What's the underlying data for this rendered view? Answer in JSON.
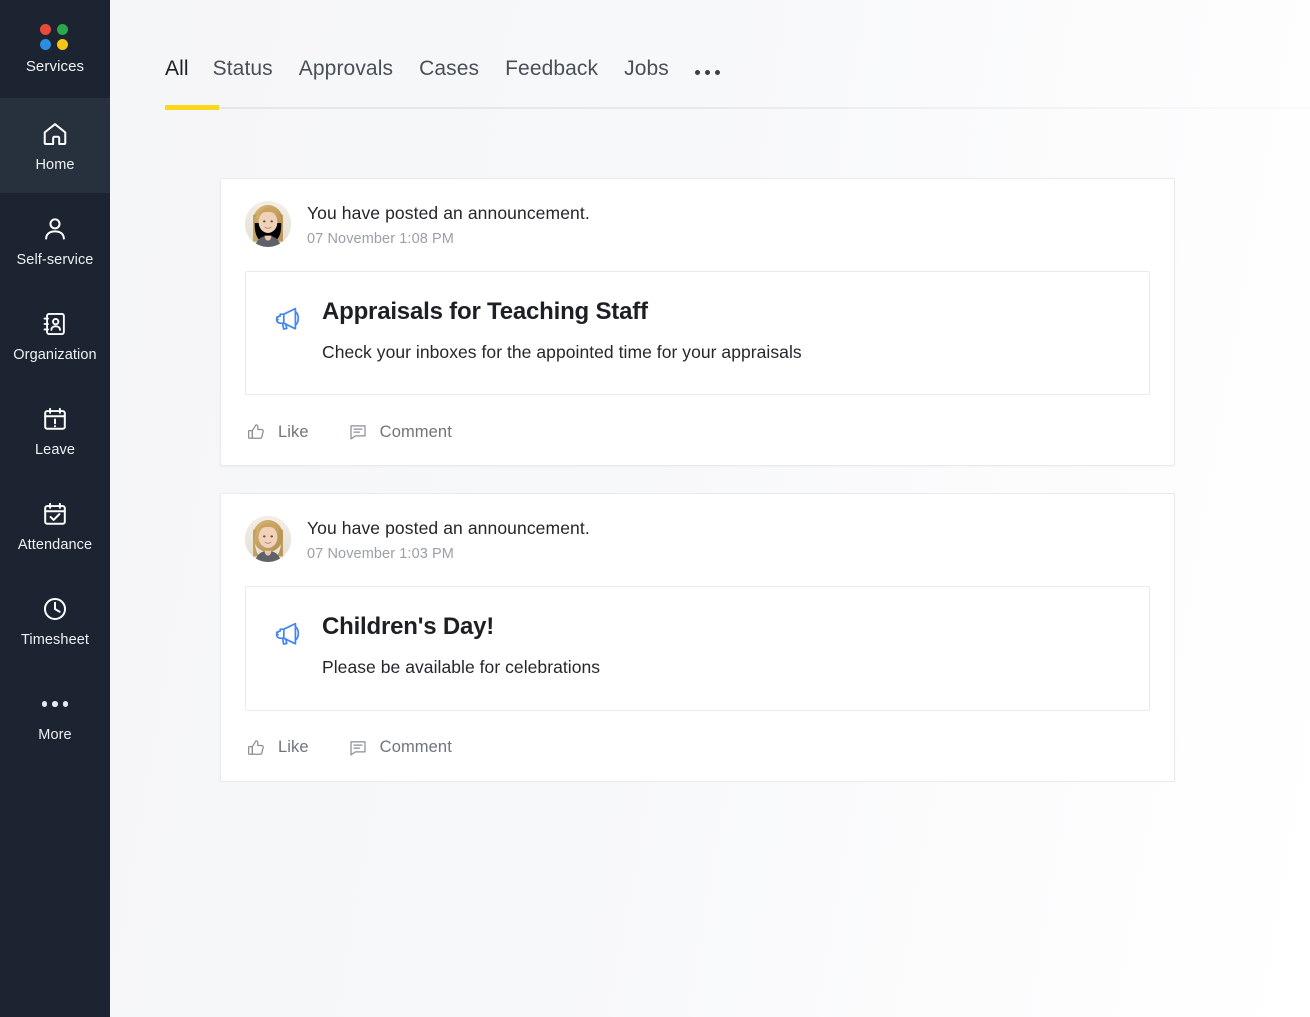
{
  "sidebar": {
    "brand": {
      "label": "Services",
      "dots": [
        {
          "name": "logo-dot-red",
          "color": "#e84b3c"
        },
        {
          "name": "logo-dot-green",
          "color": "#2aa84a"
        },
        {
          "name": "logo-dot-blue",
          "color": "#2c8ee0"
        },
        {
          "name": "logo-dot-yellow",
          "color": "#f5c518"
        }
      ]
    },
    "items": [
      {
        "label": "Home",
        "icon": "home-icon",
        "active": true
      },
      {
        "label": "Self-service",
        "icon": "user-icon",
        "active": false
      },
      {
        "label": "Organization",
        "icon": "address-book-icon",
        "active": false
      },
      {
        "label": "Leave",
        "icon": "calendar-alert-icon",
        "active": false
      },
      {
        "label": "Attendance",
        "icon": "calendar-check-icon",
        "active": false
      },
      {
        "label": "Timesheet",
        "icon": "clock-icon",
        "active": false
      },
      {
        "label": "More",
        "icon": "ellipsis-icon",
        "active": false
      }
    ]
  },
  "tabs": {
    "items": [
      {
        "label": "All",
        "active": true
      },
      {
        "label": "Status",
        "active": false
      },
      {
        "label": "Approvals",
        "active": false
      },
      {
        "label": "Cases",
        "active": false
      },
      {
        "label": "Feedback",
        "active": false
      },
      {
        "label": "Jobs",
        "active": false
      }
    ],
    "overflow_icon": "ellipsis-icon",
    "active_accent_color": "#f9d71c"
  },
  "feed": {
    "posts": [
      {
        "avatar": "user-avatar-photo",
        "header": "You have posted an announcement.",
        "timestamp": "07 November 1:08 PM",
        "announcement": {
          "icon": "megaphone-icon",
          "icon_color": "#4285f4",
          "title": "Appraisals for Teaching Staff",
          "description": "Check your inboxes for the appointed time for your appraisals"
        },
        "actions": [
          {
            "label": "Like",
            "icon": "thumbs-up-icon"
          },
          {
            "label": "Comment",
            "icon": "comment-bubble-icon"
          }
        ]
      },
      {
        "avatar": "user-avatar-photo",
        "header": "You have posted an announcement.",
        "timestamp": "07 November 1:03 PM",
        "announcement": {
          "icon": "megaphone-icon",
          "icon_color": "#4285f4",
          "title": "Children's Day!",
          "description": "Please be available for celebrations"
        },
        "actions": [
          {
            "label": "Like",
            "icon": "thumbs-up-icon"
          },
          {
            "label": "Comment",
            "icon": "comment-bubble-icon"
          }
        ]
      }
    ]
  }
}
